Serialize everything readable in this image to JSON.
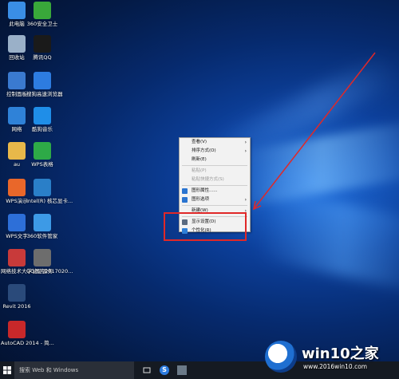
{
  "desktop": {
    "icons": [
      {
        "label": "此电脑",
        "icon": "computer-icon",
        "color": "#3a8ee6"
      },
      {
        "label": "360安全卫士",
        "icon": "360-security-icon",
        "color": "#39a83a"
      },
      {
        "label": "回收站",
        "icon": "recycle-bin-icon",
        "color": "#9ab0c8"
      },
      {
        "label": "腾讯QQ",
        "icon": "qq-icon",
        "color": "#1a1a1a"
      },
      {
        "label": "控制面板",
        "icon": "control-panel-icon",
        "color": "#3a7ad0"
      },
      {
        "label": "搜狗高速浏览器",
        "icon": "sogou-browser-icon",
        "color": "#2d7ce0"
      },
      {
        "label": "网络",
        "icon": "network-icon",
        "color": "#2f82d8"
      },
      {
        "label": "酷狗音乐",
        "icon": "kugou-icon",
        "color": "#1f8ee8"
      },
      {
        "label": "au",
        "icon": "folder-icon",
        "color": "#e8b84a"
      },
      {
        "label": "WPS表格",
        "icon": "wps-sheet-icon",
        "color": "#2eaa47"
      },
      {
        "label": "WPS演示",
        "icon": "wps-presentation-icon",
        "color": "#e9672a"
      },
      {
        "label": "Intel(R) 核芯显卡...",
        "icon": "intel-graphics-icon",
        "color": "#2a7fc8"
      },
      {
        "label": "WPS文字",
        "icon": "wps-writer-icon",
        "color": "#2d6fd8"
      },
      {
        "label": "360软件管家",
        "icon": "360-software-icon",
        "color": "#3d9ae6"
      },
      {
        "label": "网络技术大学认证服务",
        "icon": "network-app-icon",
        "color": "#c83a3a"
      },
      {
        "label": "QQ图片2017020...",
        "icon": "image-file-icon",
        "color": "#6d6d6d"
      },
      {
        "label": "Revit 2016",
        "icon": "revit-icon",
        "color": "#2a4a7a"
      },
      {
        "label": "AutoCAD 2014 - 简...",
        "icon": "autocad-icon",
        "color": "#c8282a"
      }
    ]
  },
  "context_menu": {
    "items": [
      {
        "label": "查看(V)",
        "submenu": true,
        "disabled": false
      },
      {
        "label": "排序方式(O)",
        "submenu": true,
        "disabled": false
      },
      {
        "label": "刷新(E)",
        "submenu": false,
        "disabled": false
      },
      {
        "sep": true
      },
      {
        "label": "粘贴(P)",
        "submenu": false,
        "disabled": true
      },
      {
        "label": "粘贴快捷方式(S)",
        "submenu": false,
        "disabled": true
      },
      {
        "sep": true
      },
      {
        "label": "图形属性......",
        "submenu": false,
        "disabled": false,
        "icon_color": "#2a74d0"
      },
      {
        "label": "图形选项",
        "submenu": true,
        "disabled": false,
        "icon_color": "#2a74d0"
      },
      {
        "sep": true
      },
      {
        "label": "新建(W)",
        "submenu": true,
        "disabled": false
      },
      {
        "sep": true
      },
      {
        "label": "显示设置(D)",
        "submenu": false,
        "disabled": false,
        "icon_color": "#5a6a80"
      },
      {
        "label": "个性化(R)",
        "submenu": false,
        "disabled": false,
        "icon_color": "#2f7fd8"
      }
    ]
  },
  "taskbar": {
    "search_placeholder": "搜索 Web 和 Windows"
  },
  "watermark": {
    "title": "win10之家",
    "url": "www.2016win10.com"
  },
  "colors": {
    "highlight": "#e02828",
    "accent": "#0a3f9e"
  }
}
